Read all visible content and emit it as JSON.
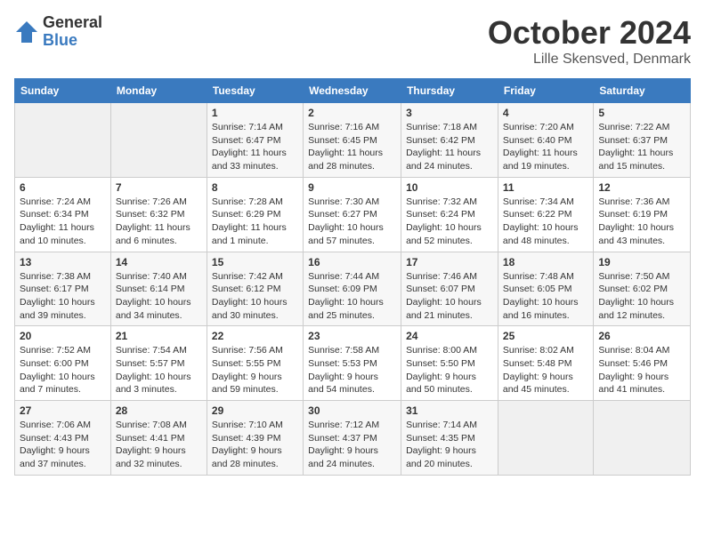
{
  "header": {
    "logo_general": "General",
    "logo_blue": "Blue",
    "title": "October 2024",
    "subtitle": "Lille Skensved, Denmark"
  },
  "columns": [
    "Sunday",
    "Monday",
    "Tuesday",
    "Wednesday",
    "Thursday",
    "Friday",
    "Saturday"
  ],
  "weeks": [
    {
      "days": [
        {
          "num": "",
          "data": ""
        },
        {
          "num": "",
          "data": ""
        },
        {
          "num": "1",
          "data": "Sunrise: 7:14 AM\nSunset: 6:47 PM\nDaylight: 11 hours\nand 33 minutes."
        },
        {
          "num": "2",
          "data": "Sunrise: 7:16 AM\nSunset: 6:45 PM\nDaylight: 11 hours\nand 28 minutes."
        },
        {
          "num": "3",
          "data": "Sunrise: 7:18 AM\nSunset: 6:42 PM\nDaylight: 11 hours\nand 24 minutes."
        },
        {
          "num": "4",
          "data": "Sunrise: 7:20 AM\nSunset: 6:40 PM\nDaylight: 11 hours\nand 19 minutes."
        },
        {
          "num": "5",
          "data": "Sunrise: 7:22 AM\nSunset: 6:37 PM\nDaylight: 11 hours\nand 15 minutes."
        }
      ]
    },
    {
      "days": [
        {
          "num": "6",
          "data": "Sunrise: 7:24 AM\nSunset: 6:34 PM\nDaylight: 11 hours\nand 10 minutes."
        },
        {
          "num": "7",
          "data": "Sunrise: 7:26 AM\nSunset: 6:32 PM\nDaylight: 11 hours\nand 6 minutes."
        },
        {
          "num": "8",
          "data": "Sunrise: 7:28 AM\nSunset: 6:29 PM\nDaylight: 11 hours\nand 1 minute."
        },
        {
          "num": "9",
          "data": "Sunrise: 7:30 AM\nSunset: 6:27 PM\nDaylight: 10 hours\nand 57 minutes."
        },
        {
          "num": "10",
          "data": "Sunrise: 7:32 AM\nSunset: 6:24 PM\nDaylight: 10 hours\nand 52 minutes."
        },
        {
          "num": "11",
          "data": "Sunrise: 7:34 AM\nSunset: 6:22 PM\nDaylight: 10 hours\nand 48 minutes."
        },
        {
          "num": "12",
          "data": "Sunrise: 7:36 AM\nSunset: 6:19 PM\nDaylight: 10 hours\nand 43 minutes."
        }
      ]
    },
    {
      "days": [
        {
          "num": "13",
          "data": "Sunrise: 7:38 AM\nSunset: 6:17 PM\nDaylight: 10 hours\nand 39 minutes."
        },
        {
          "num": "14",
          "data": "Sunrise: 7:40 AM\nSunset: 6:14 PM\nDaylight: 10 hours\nand 34 minutes."
        },
        {
          "num": "15",
          "data": "Sunrise: 7:42 AM\nSunset: 6:12 PM\nDaylight: 10 hours\nand 30 minutes."
        },
        {
          "num": "16",
          "data": "Sunrise: 7:44 AM\nSunset: 6:09 PM\nDaylight: 10 hours\nand 25 minutes."
        },
        {
          "num": "17",
          "data": "Sunrise: 7:46 AM\nSunset: 6:07 PM\nDaylight: 10 hours\nand 21 minutes."
        },
        {
          "num": "18",
          "data": "Sunrise: 7:48 AM\nSunset: 6:05 PM\nDaylight: 10 hours\nand 16 minutes."
        },
        {
          "num": "19",
          "data": "Sunrise: 7:50 AM\nSunset: 6:02 PM\nDaylight: 10 hours\nand 12 minutes."
        }
      ]
    },
    {
      "days": [
        {
          "num": "20",
          "data": "Sunrise: 7:52 AM\nSunset: 6:00 PM\nDaylight: 10 hours\nand 7 minutes."
        },
        {
          "num": "21",
          "data": "Sunrise: 7:54 AM\nSunset: 5:57 PM\nDaylight: 10 hours\nand 3 minutes."
        },
        {
          "num": "22",
          "data": "Sunrise: 7:56 AM\nSunset: 5:55 PM\nDaylight: 9 hours\nand 59 minutes."
        },
        {
          "num": "23",
          "data": "Sunrise: 7:58 AM\nSunset: 5:53 PM\nDaylight: 9 hours\nand 54 minutes."
        },
        {
          "num": "24",
          "data": "Sunrise: 8:00 AM\nSunset: 5:50 PM\nDaylight: 9 hours\nand 50 minutes."
        },
        {
          "num": "25",
          "data": "Sunrise: 8:02 AM\nSunset: 5:48 PM\nDaylight: 9 hours\nand 45 minutes."
        },
        {
          "num": "26",
          "data": "Sunrise: 8:04 AM\nSunset: 5:46 PM\nDaylight: 9 hours\nand 41 minutes."
        }
      ]
    },
    {
      "days": [
        {
          "num": "27",
          "data": "Sunrise: 7:06 AM\nSunset: 4:43 PM\nDaylight: 9 hours\nand 37 minutes."
        },
        {
          "num": "28",
          "data": "Sunrise: 7:08 AM\nSunset: 4:41 PM\nDaylight: 9 hours\nand 32 minutes."
        },
        {
          "num": "29",
          "data": "Sunrise: 7:10 AM\nSunset: 4:39 PM\nDaylight: 9 hours\nand 28 minutes."
        },
        {
          "num": "30",
          "data": "Sunrise: 7:12 AM\nSunset: 4:37 PM\nDaylight: 9 hours\nand 24 minutes."
        },
        {
          "num": "31",
          "data": "Sunrise: 7:14 AM\nSunset: 4:35 PM\nDaylight: 9 hours\nand 20 minutes."
        },
        {
          "num": "",
          "data": ""
        },
        {
          "num": "",
          "data": ""
        }
      ]
    }
  ]
}
